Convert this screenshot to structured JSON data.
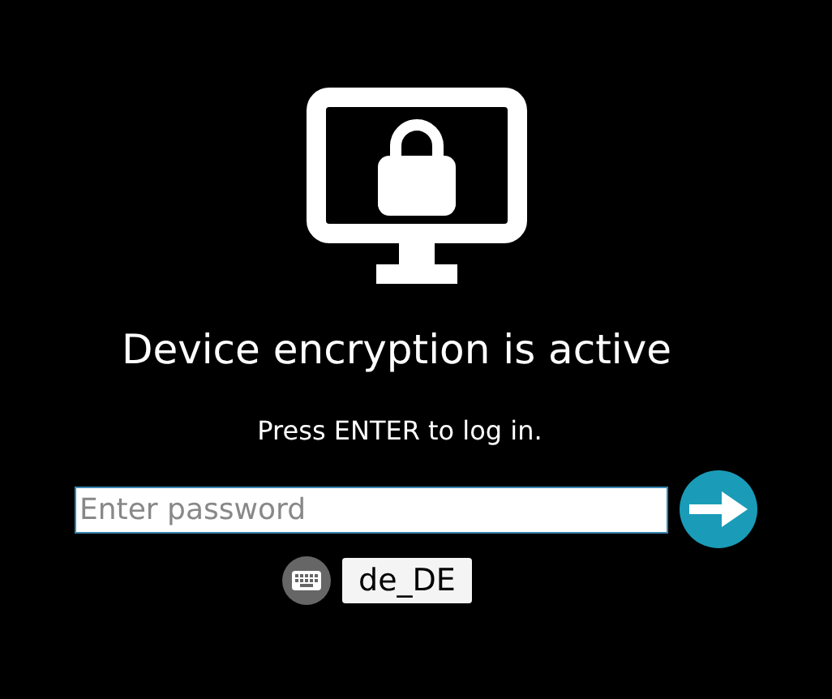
{
  "title": "Device encryption is active",
  "instruction": "Press ENTER to log in.",
  "password": {
    "placeholder": "Enter password"
  },
  "keyboard_layout": "de_DE"
}
